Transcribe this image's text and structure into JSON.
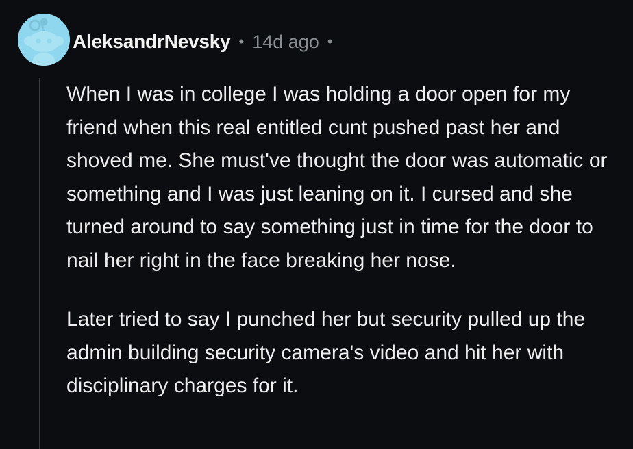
{
  "comment": {
    "avatar": {
      "icon": "reddit-snoo-avatar-icon",
      "background_color": "#8fd7ee"
    },
    "username": "AleksandrNevsky",
    "timestamp": "14d ago",
    "paragraphs": [
      "When I was in college I was holding a door open for my friend when this real entitled cunt pushed past her and shoved me. She must've thought the door was automatic or something and I was just leaning on it. I cursed and she turned around to say something just in time for the door to nail her right in the face breaking her nose.",
      "Later tried to say I punched her but security pulled up the admin building security camera's video and hit her with disciplinary charges for it."
    ]
  }
}
